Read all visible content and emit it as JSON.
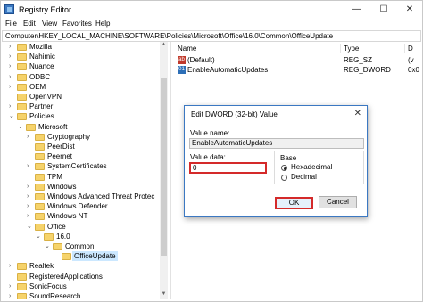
{
  "window": {
    "title": "Registry Editor",
    "min_glyph": "—",
    "max_glyph": "☐",
    "close_glyph": "✕"
  },
  "menu": [
    "File",
    "Edit",
    "View",
    "Favorites",
    "Help"
  ],
  "address": "Computer\\HKEY_LOCAL_MACHINE\\SOFTWARE\\Policies\\Microsoft\\Office\\16.0\\Common\\OfficeUpdate",
  "tree": [
    {
      "label": "Mozilla",
      "level": 2,
      "chevron": "›"
    },
    {
      "label": "Nahimic",
      "level": 2,
      "chevron": "›"
    },
    {
      "label": "Nuance",
      "level": 2,
      "chevron": "›"
    },
    {
      "label": "ODBC",
      "level": 2,
      "chevron": "›"
    },
    {
      "label": "OEM",
      "level": 2,
      "chevron": "›"
    },
    {
      "label": "OpenVPN",
      "level": 2,
      "chevron": ""
    },
    {
      "label": "Partner",
      "level": 2,
      "chevron": "›"
    },
    {
      "label": "Policies",
      "level": 2,
      "chevron": "⌄"
    },
    {
      "label": "Microsoft",
      "level": 3,
      "chevron": "⌄"
    },
    {
      "label": "Cryptography",
      "level": 4,
      "chevron": "›"
    },
    {
      "label": "PeerDist",
      "level": 4,
      "chevron": ""
    },
    {
      "label": "Peernet",
      "level": 4,
      "chevron": ""
    },
    {
      "label": "SystemCertificates",
      "level": 4,
      "chevron": "›"
    },
    {
      "label": "TPM",
      "level": 4,
      "chevron": ""
    },
    {
      "label": "Windows",
      "level": 4,
      "chevron": "›"
    },
    {
      "label": "Windows Advanced Threat Protec",
      "level": 4,
      "chevron": "›"
    },
    {
      "label": "Windows Defender",
      "level": 4,
      "chevron": "›"
    },
    {
      "label": "Windows NT",
      "level": 4,
      "chevron": "›"
    },
    {
      "label": "Office",
      "level": 4,
      "chevron": "⌄"
    },
    {
      "label": "16.0",
      "level": 5,
      "chevron": "⌄"
    },
    {
      "label": "Common",
      "level": 6,
      "chevron": "⌄"
    },
    {
      "label": "OfficeUpdate",
      "level": 7,
      "chevron": "",
      "selected": true
    },
    {
      "label": "Realtek",
      "level": 2,
      "chevron": "›"
    },
    {
      "label": "RegisteredApplications",
      "level": 2,
      "chevron": ""
    },
    {
      "label": "SonicFocus",
      "level": 2,
      "chevron": "›"
    },
    {
      "label": "SoundResearch",
      "level": 2,
      "chevron": "›"
    }
  ],
  "list": {
    "columns": {
      "name": "Name",
      "type": "Type",
      "data": "D"
    },
    "rows": [
      {
        "name": "(Default)",
        "type": "REG_SZ",
        "data": "(v",
        "icon": "string-value-icon",
        "icon_glyph": "ab"
      },
      {
        "name": "EnableAutomaticUpdates",
        "type": "REG_DWORD",
        "data": "0x0",
        "icon": "dword-value-icon",
        "icon_glyph": "01"
      }
    ]
  },
  "dialog": {
    "title": "Edit DWORD (32-bit) Value",
    "close_glyph": "✕",
    "value_name_label": "Value name:",
    "value_name": "EnableAutomaticUpdates",
    "value_data_label": "Value data:",
    "value_data": "0",
    "base_label": "Base",
    "hex_label": "Hexadecimal",
    "dec_label": "Decimal",
    "base_selected": "Hexadecimal",
    "ok_label": "OK",
    "cancel_label": "Cancel",
    "highlight_color": "#d42a2a"
  }
}
